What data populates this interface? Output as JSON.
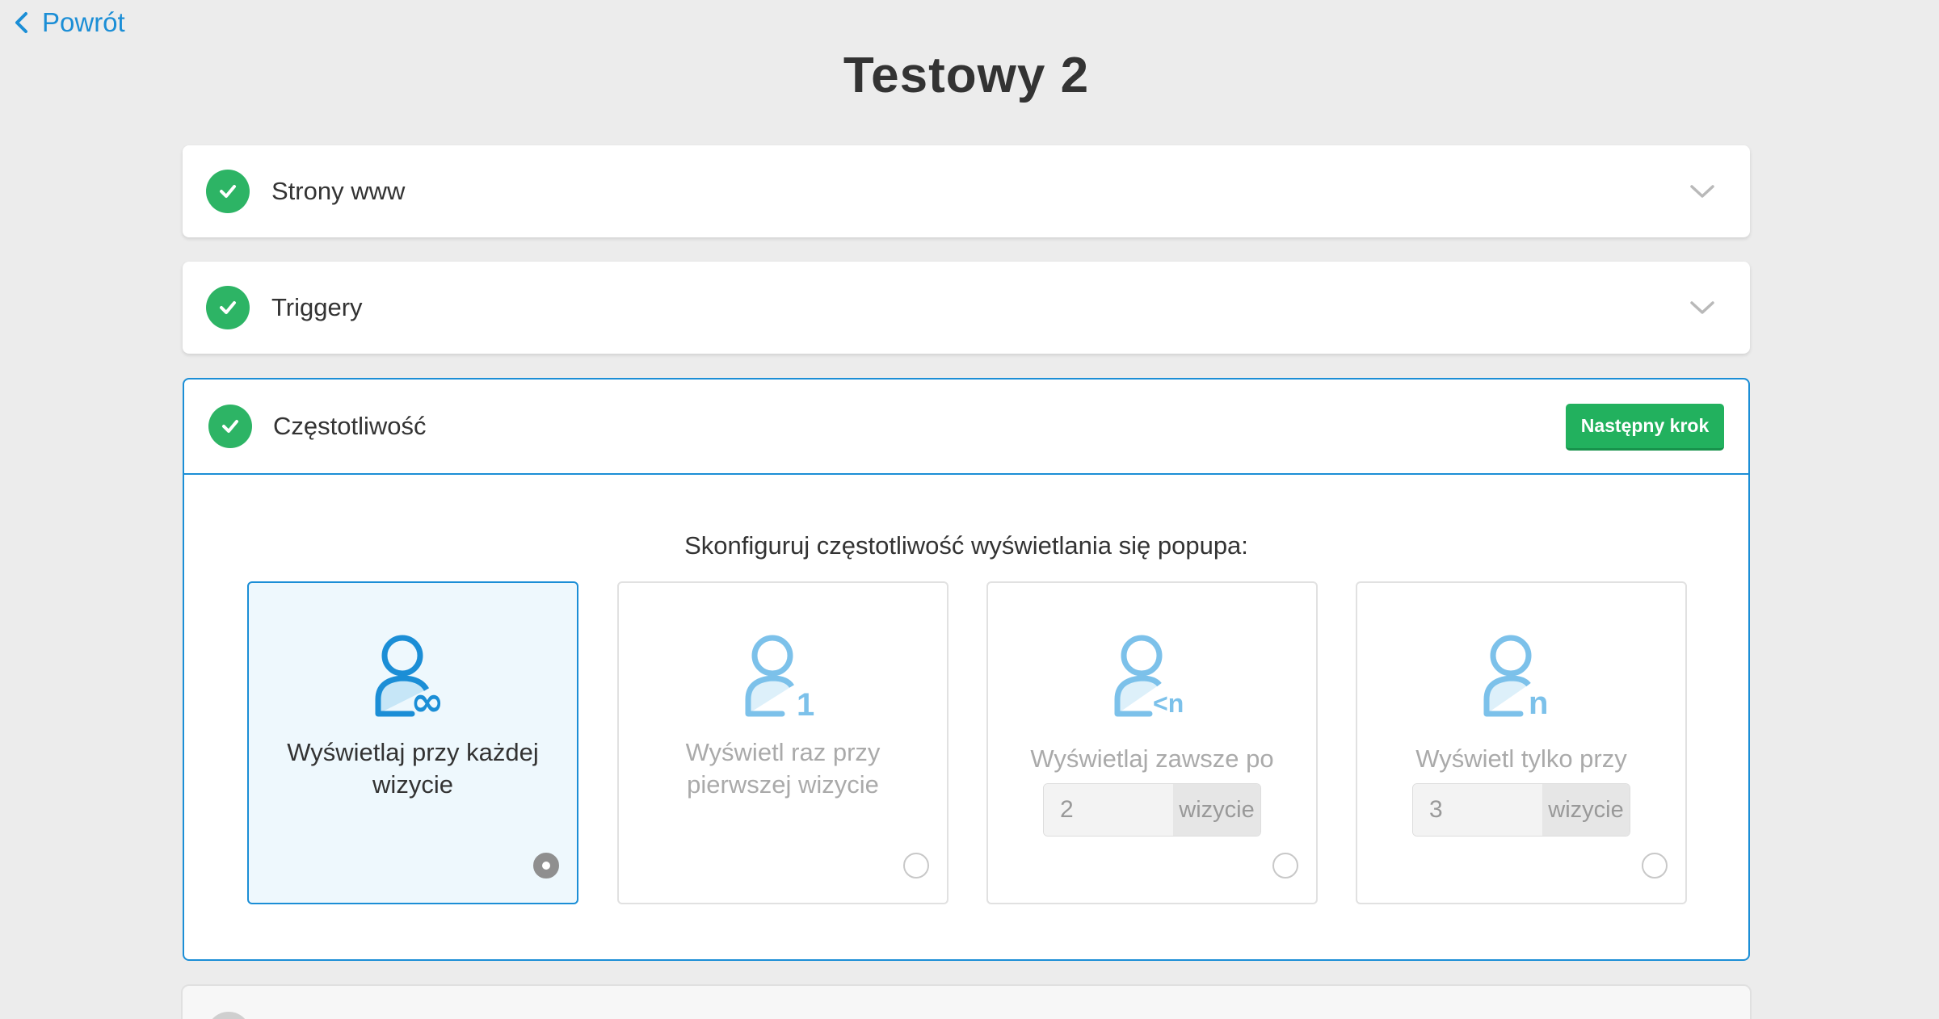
{
  "nav": {
    "back_label": "Powrót"
  },
  "page": {
    "title": "Testowy 2"
  },
  "sections": [
    {
      "title": "Strony www"
    },
    {
      "title": "Triggery"
    },
    {
      "title": "Częstotliwość",
      "next_button": "Następny krok"
    }
  ],
  "frequency": {
    "prompt": "Skonfiguruj częstotliwość wyświetlania się popupa:",
    "options": [
      {
        "label": "Wyświetlaj przy każdej wizycie",
        "icon": "user-infinity-icon",
        "selected": true
      },
      {
        "label": "Wyświetl raz przy pierwszej wizycie",
        "icon": "user-one-icon",
        "selected": false
      },
      {
        "label": "Wyświetlaj zawsze po",
        "icon": "user-less-n-icon",
        "selected": false,
        "value": "2",
        "unit": "wizycie"
      },
      {
        "label": "Wyświetl tylko przy",
        "icon": "user-n-icon",
        "selected": false,
        "value": "3",
        "unit": "wizycie"
      }
    ]
  },
  "colors": {
    "accent": "#1b8ed6",
    "success": "#22b15e",
    "selected_bg": "#eef8fd"
  }
}
